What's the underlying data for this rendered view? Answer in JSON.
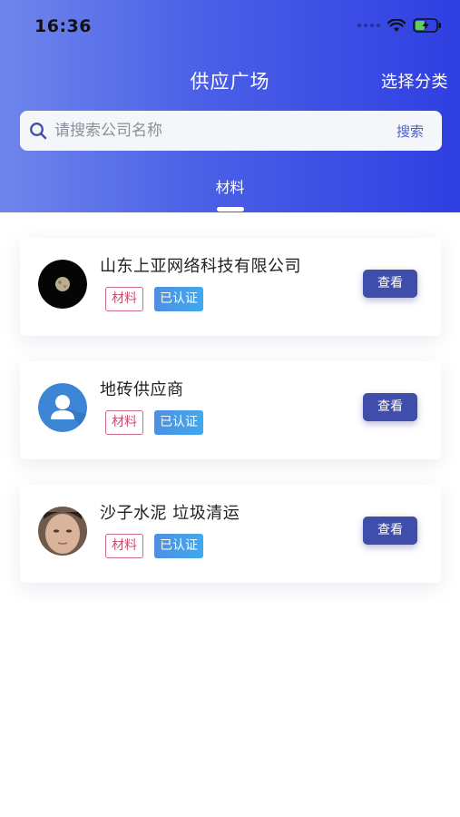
{
  "status_bar": {
    "time": "16:36",
    "icons": [
      "signal-dots-icon",
      "wifi-icon",
      "battery-charging-icon"
    ]
  },
  "nav": {
    "title": "供应广场",
    "action_label": "选择分类"
  },
  "search": {
    "placeholder": "请搜索公司名称",
    "value": "",
    "button_label": "搜索"
  },
  "tabs": [
    {
      "label": "材料",
      "active": true
    }
  ],
  "suppliers": [
    {
      "name": "山东上亚网络科技有限公司",
      "tags": [
        "材料",
        "已认证"
      ],
      "view_label": "查看",
      "avatar": "moon-photo-avatar"
    },
    {
      "name": "地砖供应商",
      "tags": [
        "材料",
        "已认证"
      ],
      "view_label": "查看",
      "avatar": "default-user-avatar"
    },
    {
      "name": "沙子水泥 垃圾清运",
      "tags": [
        "材料",
        "已认证"
      ],
      "view_label": "查看",
      "avatar": "person-photo-avatar"
    }
  ],
  "colors": {
    "header_gradient_start": "#6f86ec",
    "header_gradient_end": "#2f3fe2",
    "view_button": "#3f4eab",
    "tag_material_border": "#c96a86",
    "tag_verified": "#4f8fe2"
  }
}
